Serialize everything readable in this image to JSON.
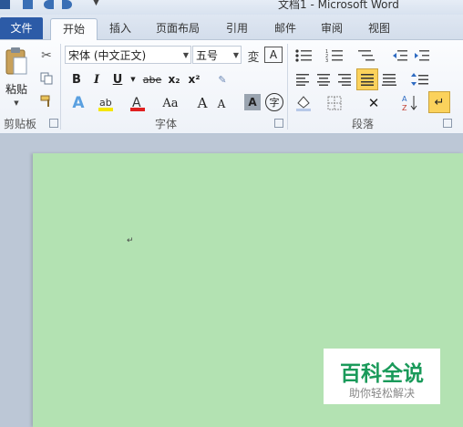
{
  "window": {
    "title": "文档1 - Microsoft Word"
  },
  "tabs": [
    "文件",
    "开始",
    "插入",
    "页面布局",
    "引用",
    "邮件",
    "审阅",
    "视图"
  ],
  "clipboard": {
    "paste_label": "粘贴",
    "group_label": "剪贴板"
  },
  "font": {
    "font_name": "宋体 (中文正文)",
    "font_size": "五号",
    "group_label": "字体",
    "buttons": {
      "bold": "B",
      "italic": "I",
      "underline": "U",
      "strike": "abe",
      "sub": "x₂",
      "sup": "x²",
      "grow": "A",
      "shrink": "A",
      "case": "Aa"
    }
  },
  "paragraph": {
    "group_label": "段落"
  },
  "document": {
    "cursor_mark": "↵"
  },
  "watermark": {
    "main": "百科全说",
    "sub": "助你轻松解决"
  },
  "colors": {
    "file_tab": "#2c5ba7",
    "page_bg": "#b3e2b2",
    "watermark_green": "#1a9a5a"
  }
}
